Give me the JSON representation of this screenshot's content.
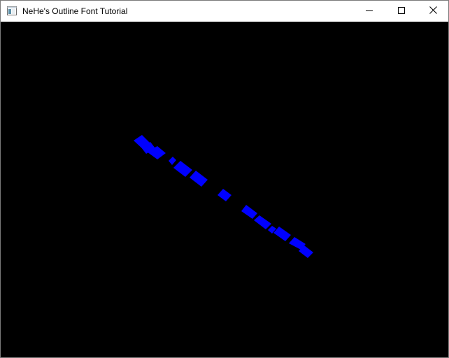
{
  "window": {
    "title": "NeHe's Outline Font Tutorial"
  },
  "icons": {
    "app": "app-window-icon",
    "minimize": "minimize-icon",
    "maximize": "maximize-icon",
    "close": "close-icon"
  },
  "viewport": {
    "background_color": "#000000",
    "glyph_color": "#0000ff"
  }
}
